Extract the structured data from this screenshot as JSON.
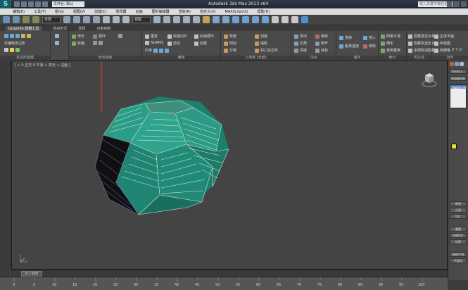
{
  "titlebar": {
    "workspace": "工作台: 默认",
    "window_title": "Autodesk 3ds Max 2013 x64",
    "search_placeholder": "键入关键字或短语"
  },
  "menu": {
    "items": [
      "编辑(E)",
      "工具(T)",
      "组(G)",
      "视图(V)",
      "创建(C)",
      "修改器",
      "动画",
      "图形编辑器",
      "渲染(R)",
      "自定义(U)",
      "MAXScript(X)",
      "帮助(H)"
    ]
  },
  "main_toolbar": {
    "filter_value": "全部",
    "view_value": "视图"
  },
  "ribbon": {
    "tabs": [
      "Graphite 建模工具",
      "自由形式",
      "选择",
      "对象绘制"
    ],
    "groups": {
      "polygon": "多边形建模",
      "modify_selection": "修改选择",
      "edit": "编辑",
      "geometry": "几何体 (全部)",
      "vertices": "顶点",
      "loops": "循环",
      "subdivision": "细分",
      "visibility": "可见性",
      "align": "对齐"
    },
    "polygon_items": [
      "可编辑多边形",
      "多边形建模"
    ],
    "ms_items": [
      "增长",
      "收缩",
      "循环"
    ],
    "edit_items": [
      "重复",
      "快速切片",
      "快速循环",
      "NURMS",
      "剪切",
      "约束",
      "创建"
    ],
    "geom_items": [
      "松弛",
      "创建",
      "附加",
      "塌陷",
      "分离",
      "封口多边形"
    ],
    "vert_items": [
      "挤出",
      "切角",
      "焊接",
      "移除",
      "断开",
      "目标"
    ],
    "loop_items": [
      "连接",
      "距离连接",
      "插入",
      "移除"
    ],
    "sub_items": [
      "网格平滑",
      "细化",
      "使用置换"
    ],
    "vis_items": [
      "隐藏选定对象",
      "隐藏未选定对象",
      "全部取消隐藏"
    ],
    "align_items": [
      "生成平面",
      "到视图",
      "到栅格",
      "X",
      "Y",
      "Z"
    ]
  },
  "viewport": {
    "label": "[ + 0 正交 0 平滑 + 高光 + 边面 ]"
  },
  "command_panel": {
    "modifier_list": "修改器列表",
    "object_name": "Dodeca...",
    "list_item": "可编辑多边形",
    "buttons": [
      "附加",
      "分离",
      "切片",
      "重置",
      "快速切片",
      "切割",
      "网格平滑",
      "平面化"
    ]
  },
  "timeline": {
    "frame_display": "0 / 100",
    "ticks": [
      "0",
      "5",
      "10",
      "15",
      "20",
      "25",
      "30",
      "35",
      "40",
      "45",
      "50",
      "55",
      "60",
      "65",
      "70",
      "75",
      "80",
      "85",
      "90",
      "95",
      "100"
    ]
  }
}
